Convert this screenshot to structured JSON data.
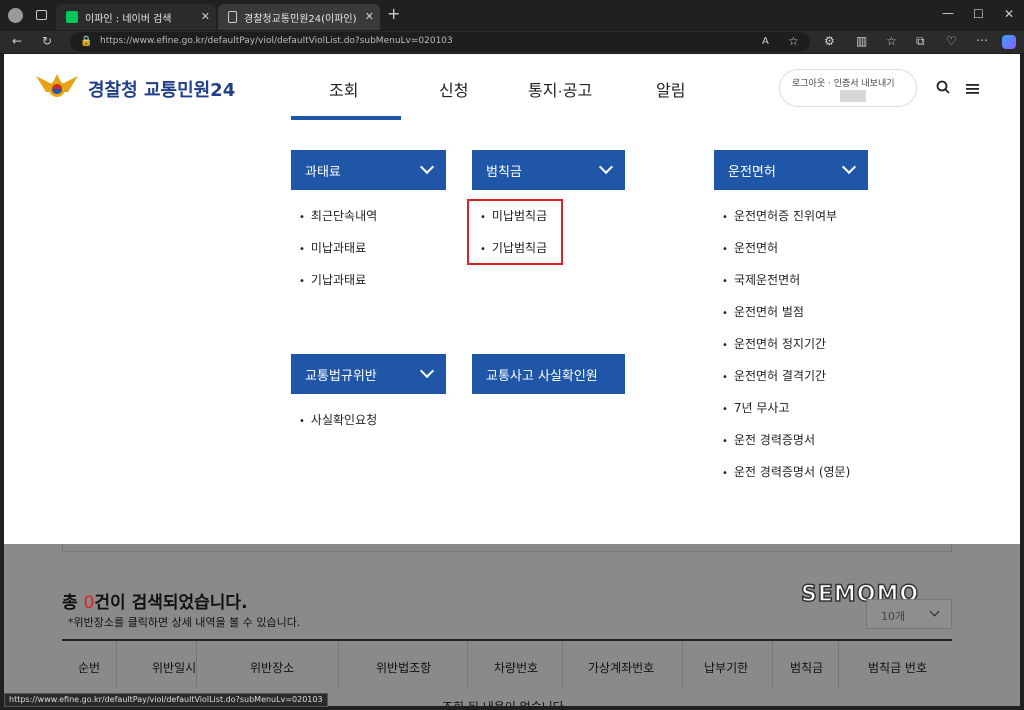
{
  "browser": {
    "tabs": [
      {
        "title": "이파인 : 네이버 검색",
        "favicon_color": "#03c75a"
      },
      {
        "title": "경찰청교통민원24(이파인)"
      }
    ],
    "new_tab": "+",
    "url": "https://www.efine.go.kr/defaultPay/viol/defaultViolList.do?subMenuLv=020103",
    "status_url": "https://www.efine.go.kr/defaultPay/viol/defaultViolList.do?subMenuLv=020103"
  },
  "header": {
    "logo_text": "경찰청 교통민원24",
    "nav": [
      "조회",
      "신청",
      "통지·공고",
      "알림"
    ],
    "login": "로그아웃 · 인증서 내보내기"
  },
  "menu": {
    "categories": [
      {
        "label": "과태료",
        "items": [
          "최근단속내역",
          "미납과태료",
          "기납과태료"
        ]
      },
      {
        "label": "범칙금",
        "items": [
          "미납범칙금",
          "기납범칙금"
        ]
      },
      {
        "label": "운전면허",
        "items": [
          "운전면허증 진위여부",
          "운전면허",
          "국제운전면허",
          "운전면허 벌점",
          "운전면허 정지기간",
          "운전면허 결격기간",
          "7년 무사고",
          "운전 경력증명서",
          "운전 경력증명서 (영문)"
        ]
      },
      {
        "label": "교통법규위반",
        "items": [
          "사실확인요청"
        ]
      },
      {
        "label": "교통사고 사실확인원",
        "items": []
      }
    ]
  },
  "results": {
    "prefix": "총 ",
    "count": "0",
    "suffix": "건이 검색되었습니다.",
    "note": "*위반장소를 클릭하면 상세 내역을 볼 수 있습니다.",
    "page_size": "10개",
    "columns": [
      "순번",
      "위반일시",
      "위반장소",
      "위반법조항",
      "차량번호",
      "가상계좌번호",
      "납부기한",
      "범칙금",
      "범칙금 번호"
    ],
    "empty": "조회 된 내용이 없습니다."
  },
  "watermark": "SEMOMO",
  "colors": {
    "accent": "#1f56a8",
    "highlight": "#e02020",
    "count": "#e02020"
  }
}
